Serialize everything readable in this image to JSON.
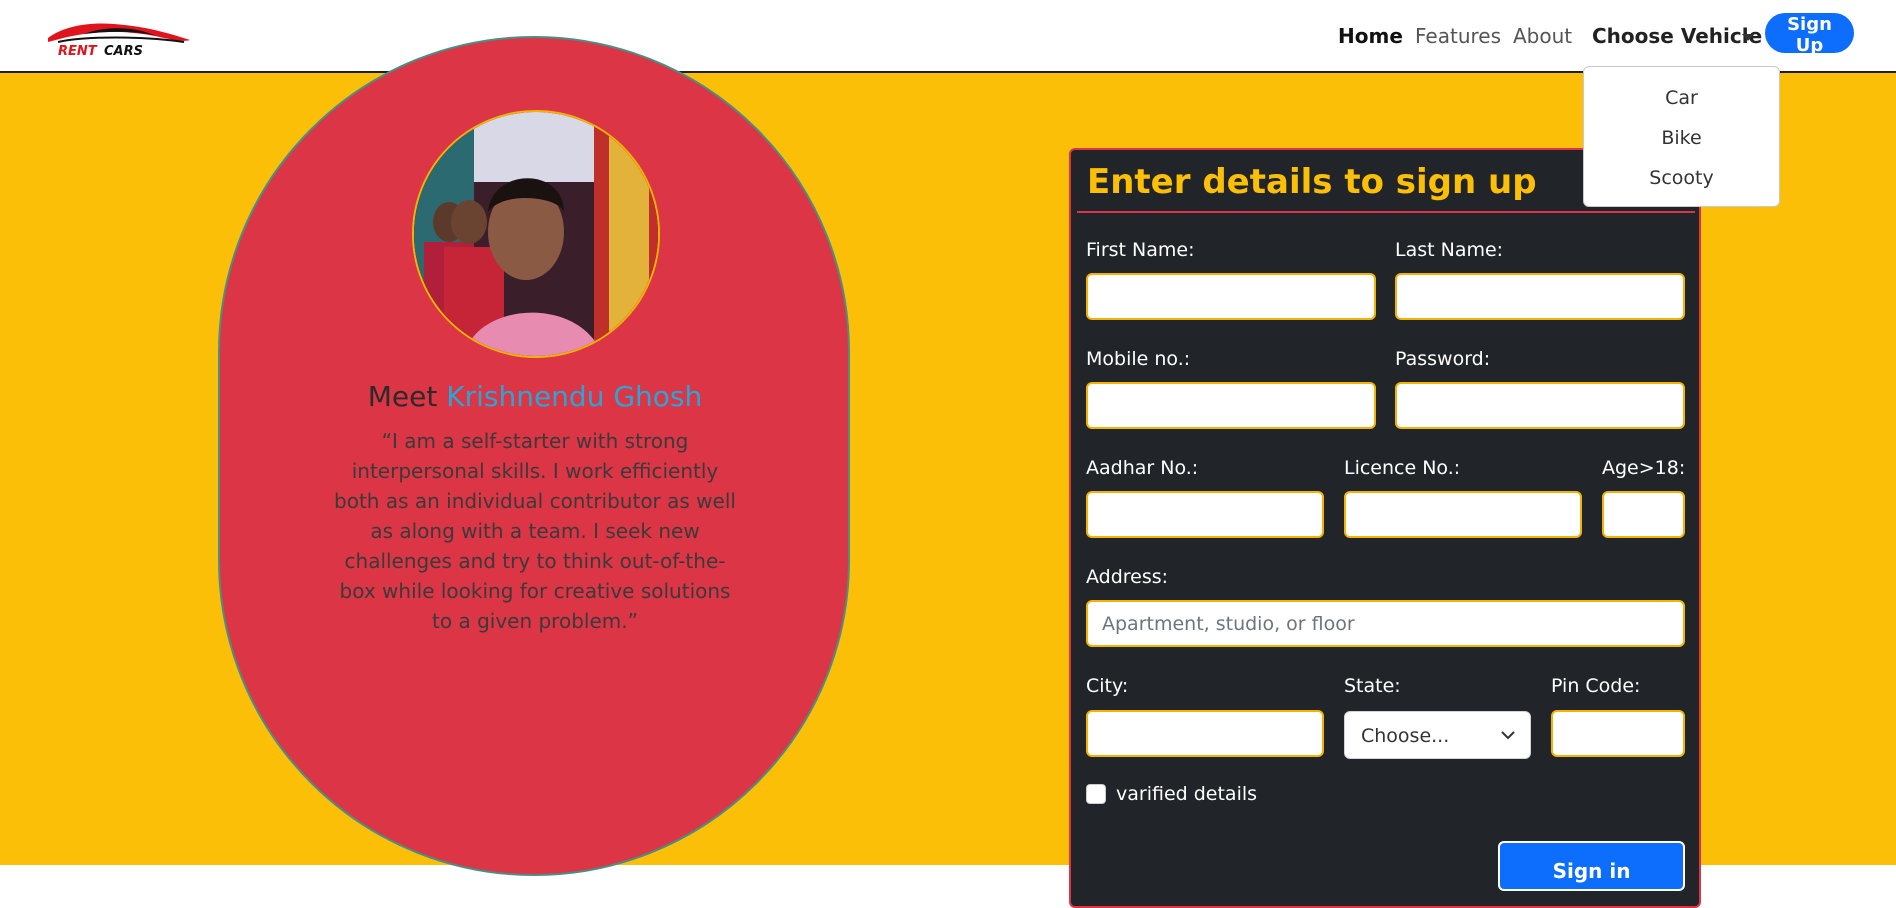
{
  "nav": {
    "logo_text": "RENT CARS",
    "items": [
      {
        "label": "Home"
      },
      {
        "label": "Features"
      },
      {
        "label": "About"
      },
      {
        "label": "Choose Vehicle"
      }
    ],
    "signup_label": "Sign Up",
    "dropdown": [
      "Car",
      "Bike",
      "Scooty"
    ]
  },
  "profile": {
    "meet_prefix": "Meet",
    "name": "Krishnendu Ghosh",
    "quote": "“I am a self-starter with strong interpersonal skills. I work efficiently both as an individual contributor as well as along with a team. I seek new challenges and try to think out-of-the-box while looking for creative solutions to a given problem.”"
  },
  "form": {
    "title": "Enter details to sign up",
    "labels": {
      "first_name": "First Name:",
      "last_name": "Last Name:",
      "mobile": "Mobile no.:",
      "password": "Password:",
      "aadhar": "Aadhar No.:",
      "licence": "Licence No.:",
      "age": "Age>18:",
      "address": "Address:",
      "city": "City:",
      "state": "State:",
      "pin": "Pin Code:"
    },
    "address_placeholder": "Apartment, studio, or floor",
    "state_selected": "Choose...",
    "checkbox_label": "varified details",
    "submit_label": "Sign in"
  },
  "colors": {
    "background": "#fcbf07",
    "card_red": "#dc3545",
    "form_dark": "#212529",
    "accent_blue": "#0d6efd",
    "name_blue": "#2aa6d6"
  }
}
